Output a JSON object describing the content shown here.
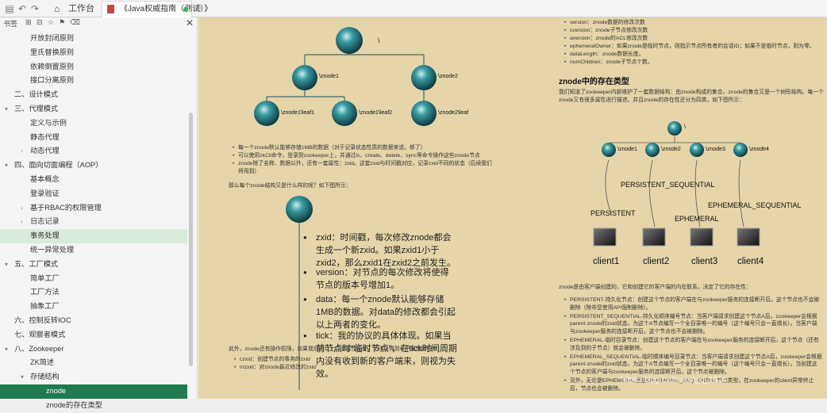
{
  "toolbar": {
    "home_tab": "工作台",
    "doc_tab": "《Java权威指南（测试）》"
  },
  "sidebar": {
    "header": "书签",
    "items": [
      {
        "label": "开放封闭原则",
        "indent": 38
      },
      {
        "label": "里氏替换原则",
        "indent": 38
      },
      {
        "label": "依赖倒置原则",
        "indent": 38
      },
      {
        "label": "接口分离原则",
        "indent": 38
      },
      {
        "label": "二、设计模式",
        "indent": 18
      },
      {
        "label": "三、代理模式",
        "indent": 18,
        "caret": "▾"
      },
      {
        "label": "定义与示例",
        "indent": 38
      },
      {
        "label": "静态代理",
        "indent": 38
      },
      {
        "label": "动态代理",
        "indent": 38,
        "caret": "›"
      },
      {
        "label": "四、面向切面编程（AOP）",
        "indent": 18,
        "caret": "▾"
      },
      {
        "label": "基本概念",
        "indent": 38
      },
      {
        "label": "登录验证",
        "indent": 38
      },
      {
        "label": "基于RBAC的权限管理",
        "indent": 38,
        "caret": "›"
      },
      {
        "label": "日志记录",
        "indent": 38,
        "caret": "›"
      },
      {
        "label": "事务处理",
        "indent": 38,
        "highlight": true
      },
      {
        "label": "统一异常处理",
        "indent": 38
      },
      {
        "label": "五、工厂模式",
        "indent": 18,
        "caret": "▾"
      },
      {
        "label": "简单工厂",
        "indent": 38
      },
      {
        "label": "工厂方法",
        "indent": 38
      },
      {
        "label": "抽象工厂",
        "indent": 38
      },
      {
        "label": "六、控制反转IOC",
        "indent": 18
      },
      {
        "label": "七、观察者模式",
        "indent": 18
      },
      {
        "label": "八、Zookeeper",
        "indent": 18,
        "caret": "▾"
      },
      {
        "label": "ZK简述",
        "indent": 38
      },
      {
        "label": "存储结构",
        "indent": 38,
        "caret": "▾"
      },
      {
        "label": "znode",
        "indent": 58,
        "active": true
      },
      {
        "label": "znode的存在类型",
        "indent": 58
      }
    ]
  },
  "left_page": {
    "tree_nodes": [
      "\\",
      "\\znode1",
      "\\znode2",
      "\\znode1\\leaf1",
      "\\znode1\\leaf2",
      "\\znode2\\leaf"
    ],
    "bullets": [
      "每一个znode默认能够存储1MB的数据（对于记录状态性质的数据来说，够了）",
      "可以使用zkCli命令，登录到zookeeper上，并通过ls、create、delete、sync等命令操作这些znode节点",
      "znode除了名称、数据以外，还有一套属性：zxid。这套zxid与时间戳对应，记录zxid不同的状态（后续我们将用到）"
    ],
    "question": "那么每个znode结构又是什么样的呢？如下图所示：",
    "notes": [
      "zxid：时间戳，每次修改znode都会生成一个新zxid。如果zxid1小于zxid2，那么zxid1在zxid2之前发生。",
      "version：对节点的每次修改将使得节点的版本号增加1。",
      "data：每一个znode默认能够存储1MB的数据。对data的修改都会引起以上两者的变化。",
      "tick：我的协议的具体体现。如果当前节点时“临时节点”，在tick时间周期内没有收到新的客户端来，则视为失效。"
    ],
    "bottom_text": "此外，znode还有操作权限，如果我们把以上几类属性细化，又可以得到以下属性的细节：",
    "bottom_bullets": [
      "czxid：创建节点的事务的zxid",
      "mzxid：对znode最近修改的zxid"
    ]
  },
  "right_page": {
    "top_bullets": [
      "version：znode数据的修改次数",
      "cversion：znode子节点修改次数",
      "aversion：znode的ACL修改次数",
      "ephemeralOwner：如果znode是临时节点，则指示节点所有者的会话ID；如果不是临时节点，则为零。",
      "dataLength：znode数据长度。",
      "numChildren：znode子节点个数。"
    ],
    "heading": "znode中的存在类型",
    "intro": "我们知道了zookeeper内部维护了一套数据结构：由znode构成的集合，znode的集合又是一个树形结构。每一个znode又有很多属性进行描述。并且znode的存在性还分为四类，如下图所示：",
    "diagram": {
      "root": "\\",
      "nodes": [
        "\\znode1",
        "\\znode2",
        "\\znode3",
        "\\znode4"
      ],
      "labels": [
        "PERSISTENT_SEQUENTIAL",
        "PERSISTENT",
        "EPHEMERAL",
        "EPHEMERAL_SEQUENTIAL"
      ],
      "clients": [
        "client1",
        "client2",
        "client3",
        "client4"
      ]
    },
    "para": "znode是由客户端创建的，它和创建它的客户端的内在联系，决定了它的存在性：",
    "types": [
      "PERSISTENT-持久化节点：创建这个节点的客户端在与zookeeper服务的连接断开后，这个节点也不会被删除（除非您使用API强制删除）。",
      "PERSISTENT_SEQUENTIAL-持久化顺序编号节点：当客户端请求创建这个节点A后，zookeeper会根据parent-znode的zxid状态，为这个A节点编写一个全目录唯一的编号（这个编号只会一直增长）。当客户端与zookeeper服务的连接断开后，这个节点也不会被删除。",
      "EPHEMERAL-临时目录节点：创建这个节点的客户端在与zookeeper服务的连接断开后，这个节点（还有涉及到的子节点）就会被删除。",
      "EPHEMERAL_SEQUENTIAL-临时顺序编号目录节点：当客户端请求创建这个节点A后，zookeeper会根据parent-znode的zxid状态，为这个A节点编写一个全目录唯一的编号（这个编号只会一直增长）。当创建这个节点的客户端与zookeeper服务的连接断开后，这个节点被删除。",
      "另外，无论是EPHEMERAL还是EPHEMERAL_SEQUENTIAL节点类型，在zookeeper的client异常终止后，节点也会被删除。"
    ],
    "watermark": "https://blog.csdn.net/gjq_1014"
  }
}
